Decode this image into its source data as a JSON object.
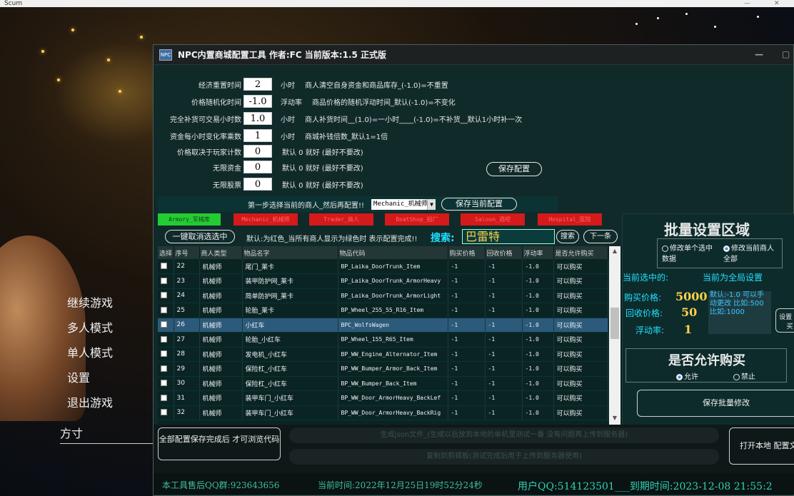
{
  "host": {
    "title": "Scum",
    "min": "—",
    "close": "✕"
  },
  "game_menu": [
    "继续游戏",
    "多人模式",
    "单人模式",
    "设置",
    "退出游戏"
  ],
  "player_name": "方寸",
  "window": {
    "icon_text": "NPC",
    "title": "NPC内置商城配置工具 作者:FC   当前版本:1.5 正式版",
    "min": "—",
    "max": "▢"
  },
  "settings": [
    {
      "label": "经济重置时间",
      "value": "2",
      "unit": "小时",
      "desc": "商人清空自身资金和商品库存_(-1.0)=不重置"
    },
    {
      "label": "价格随机化时间",
      "value": "-1.0",
      "unit": "浮动率",
      "desc": "商品价格的随机浮动时间_默认(-1.0)=不变化"
    },
    {
      "label": "完全补货可交易小时数",
      "value": "1.0",
      "unit": "小时",
      "desc": "商人补货时间__(1.0)=一小时____(-1.0)=不补货__默认1小时补一次"
    },
    {
      "label": "资金每小时变化率乘数",
      "value": "1",
      "unit": "小时",
      "desc": "商城补钱倍数_默认1=1倍"
    },
    {
      "label": "价格取决于玩家计数",
      "value": "0",
      "unit": "",
      "desc": "默认 0 就好 (最好不要改)"
    },
    {
      "label": "无限资金",
      "value": "0",
      "unit": "",
      "desc": "默认 0 就好 (最好不要改)"
    },
    {
      "label": "无限股票",
      "value": "0",
      "unit": "",
      "desc": "默认 0 就好 (最好不要改)"
    }
  ],
  "save_config_label": "保存配置",
  "step": {
    "label": "第一步选择当前的商人_然后再配置!!",
    "selected_merchant": "Mechanic_机械师",
    "save_current_label": "保存当前配置"
  },
  "tabs": [
    "Armory_军械库",
    "Mechanic_机械师",
    "Trader_商人",
    "BoatShop_船厂",
    "Saloon_酒吧",
    "Hospital_医院"
  ],
  "deselect_label": "一键取消选选中",
  "hint": "默认:为红色_当所有商人显示为绿色时 表示配置完成!!",
  "search": {
    "label": "搜索:",
    "value": "巴雷特",
    "button": "搜索",
    "next": "下一条"
  },
  "table": {
    "headers": [
      "选择",
      "序号",
      "商人类型",
      "物品名字",
      "物品代码",
      "购买价格",
      "回收价格",
      "浮动率",
      "是否允许购买"
    ],
    "rows": [
      {
        "no": "22",
        "type": "机械师",
        "name": "尾门_莱卡",
        "code": "BP_Laika_DoorTrunk_Item",
        "buy": "-1",
        "sell": "-1",
        "rate": "-1.0",
        "allow": "可以购买"
      },
      {
        "no": "23",
        "type": "机械师",
        "name": "装甲防护网_莱卡",
        "code": "BP_Laika_DoorTrunk_ArmorHeavy",
        "buy": "-1",
        "sell": "-1",
        "rate": "-1.0",
        "allow": "可以购买"
      },
      {
        "no": "24",
        "type": "机械师",
        "name": "简单防护网_莱卡",
        "code": "BP_Laika_DoorTrunk_ArmorLight",
        "buy": "-1",
        "sell": "-1",
        "rate": "-1.0",
        "allow": "可以购买"
      },
      {
        "no": "25",
        "type": "机械师",
        "name": "轮胎_莱卡",
        "code": "BP_Wheel_255_55_R16_Item",
        "buy": "-1",
        "sell": "-1",
        "rate": "-1.0",
        "allow": "可以购买"
      },
      {
        "no": "26",
        "type": "机械师",
        "name": "小红车",
        "code": "BPC_WolfsWagen",
        "buy": "-1",
        "sell": "-1",
        "rate": "-1.0",
        "allow": "可以购买"
      },
      {
        "no": "27",
        "type": "机械师",
        "name": "轮胎_小红车",
        "code": "BP_Wheel_155_R65_Item",
        "buy": "-1",
        "sell": "-1",
        "rate": "-1.0",
        "allow": "可以购买"
      },
      {
        "no": "28",
        "type": "机械师",
        "name": "发电机_小红车",
        "code": "BP_WW_Engine_Alternator_Item",
        "buy": "-1",
        "sell": "-1",
        "rate": "-1.0",
        "allow": "可以购买"
      },
      {
        "no": "29",
        "type": "机械师",
        "name": "保险杠_小红车",
        "code": "BP_WW_Bumper_Armor_Back_Item",
        "buy": "-1",
        "sell": "-1",
        "rate": "-1.0",
        "allow": "可以购买"
      },
      {
        "no": "30",
        "type": "机械师",
        "name": "保险杠_小红车",
        "code": "BP_WW_Bumper_Back_Item",
        "buy": "-1",
        "sell": "-1",
        "rate": "-1.0",
        "allow": "可以购买"
      },
      {
        "no": "31",
        "type": "机械师",
        "name": "装甲车门_小红车",
        "code": "BP_WW_Door_ArmorHeavy_BackLef",
        "buy": "-1",
        "sell": "-1",
        "rate": "-1.0",
        "allow": "可以购买"
      },
      {
        "no": "32",
        "type": "机械师",
        "name": "装甲车门_小红车",
        "code": "BP_WW_Door_ArmorHeavy_BackRig",
        "buy": "-1",
        "sell": "-1",
        "rate": "-1.0",
        "allow": "可以购买"
      }
    ]
  },
  "batch": {
    "title": "批量设置区域",
    "mode_single": "修改单个选中数据",
    "mode_all": "修改当前商人全部",
    "current_label": "当前选中的:",
    "current_value": "当前为全局设置",
    "buy_label": "购买价格:",
    "buy_value": "5000",
    "sell_label": "回收价格:",
    "sell_value": "50",
    "rate_label": "浮动率:",
    "rate_value": "1",
    "note": "默认:-1.0 可以手动更改 比如:500 比如:1000",
    "side_button": "设置 看买",
    "allow_title": "是否允许购买",
    "allow_yes": "允许",
    "allow_no": "禁止",
    "save_label": "保存批量修改"
  },
  "bottom": {
    "full_save": "全部配置保存完成后 才可浏览代码",
    "gen_json": "生成json文件_(生成以后放到本地的单机里测试一番 没有问题再上传到服务器)",
    "copy_btn": "复制到剪辑板(测试完成后用于上传到服务器使用)",
    "open_local": "打开本地 配置文件"
  },
  "status": {
    "qq_group": "本工具售后QQ群:923643656",
    "time": "当前时间:2022年12月25日19时52分24秒",
    "user": "用户QQ:514123501___到期时间:2023-12-08 21:55:2"
  }
}
